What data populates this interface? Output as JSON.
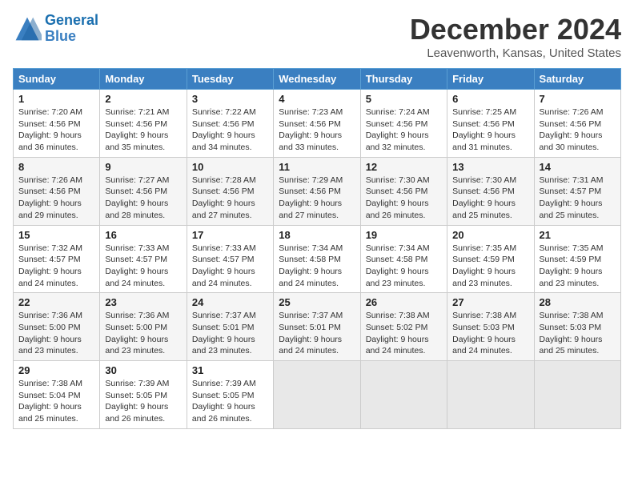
{
  "header": {
    "logo_line1": "General",
    "logo_line2": "Blue",
    "month_title": "December 2024",
    "location": "Leavenworth, Kansas, United States"
  },
  "days_of_week": [
    "Sunday",
    "Monday",
    "Tuesday",
    "Wednesday",
    "Thursday",
    "Friday",
    "Saturday"
  ],
  "weeks": [
    [
      {
        "day": "1",
        "sunrise": "7:20 AM",
        "sunset": "4:56 PM",
        "daylight": "9 hours and 36 minutes."
      },
      {
        "day": "2",
        "sunrise": "7:21 AM",
        "sunset": "4:56 PM",
        "daylight": "9 hours and 35 minutes."
      },
      {
        "day": "3",
        "sunrise": "7:22 AM",
        "sunset": "4:56 PM",
        "daylight": "9 hours and 34 minutes."
      },
      {
        "day": "4",
        "sunrise": "7:23 AM",
        "sunset": "4:56 PM",
        "daylight": "9 hours and 33 minutes."
      },
      {
        "day": "5",
        "sunrise": "7:24 AM",
        "sunset": "4:56 PM",
        "daylight": "9 hours and 32 minutes."
      },
      {
        "day": "6",
        "sunrise": "7:25 AM",
        "sunset": "4:56 PM",
        "daylight": "9 hours and 31 minutes."
      },
      {
        "day": "7",
        "sunrise": "7:26 AM",
        "sunset": "4:56 PM",
        "daylight": "9 hours and 30 minutes."
      }
    ],
    [
      {
        "day": "8",
        "sunrise": "7:26 AM",
        "sunset": "4:56 PM",
        "daylight": "9 hours and 29 minutes."
      },
      {
        "day": "9",
        "sunrise": "7:27 AM",
        "sunset": "4:56 PM",
        "daylight": "9 hours and 28 minutes."
      },
      {
        "day": "10",
        "sunrise": "7:28 AM",
        "sunset": "4:56 PM",
        "daylight": "9 hours and 27 minutes."
      },
      {
        "day": "11",
        "sunrise": "7:29 AM",
        "sunset": "4:56 PM",
        "daylight": "9 hours and 27 minutes."
      },
      {
        "day": "12",
        "sunrise": "7:30 AM",
        "sunset": "4:56 PM",
        "daylight": "9 hours and 26 minutes."
      },
      {
        "day": "13",
        "sunrise": "7:30 AM",
        "sunset": "4:56 PM",
        "daylight": "9 hours and 25 minutes."
      },
      {
        "day": "14",
        "sunrise": "7:31 AM",
        "sunset": "4:57 PM",
        "daylight": "9 hours and 25 minutes."
      }
    ],
    [
      {
        "day": "15",
        "sunrise": "7:32 AM",
        "sunset": "4:57 PM",
        "daylight": "9 hours and 24 minutes."
      },
      {
        "day": "16",
        "sunrise": "7:33 AM",
        "sunset": "4:57 PM",
        "daylight": "9 hours and 24 minutes."
      },
      {
        "day": "17",
        "sunrise": "7:33 AM",
        "sunset": "4:57 PM",
        "daylight": "9 hours and 24 minutes."
      },
      {
        "day": "18",
        "sunrise": "7:34 AM",
        "sunset": "4:58 PM",
        "daylight": "9 hours and 24 minutes."
      },
      {
        "day": "19",
        "sunrise": "7:34 AM",
        "sunset": "4:58 PM",
        "daylight": "9 hours and 23 minutes."
      },
      {
        "day": "20",
        "sunrise": "7:35 AM",
        "sunset": "4:59 PM",
        "daylight": "9 hours and 23 minutes."
      },
      {
        "day": "21",
        "sunrise": "7:35 AM",
        "sunset": "4:59 PM",
        "daylight": "9 hours and 23 minutes."
      }
    ],
    [
      {
        "day": "22",
        "sunrise": "7:36 AM",
        "sunset": "5:00 PM",
        "daylight": "9 hours and 23 minutes."
      },
      {
        "day": "23",
        "sunrise": "7:36 AM",
        "sunset": "5:00 PM",
        "daylight": "9 hours and 23 minutes."
      },
      {
        "day": "24",
        "sunrise": "7:37 AM",
        "sunset": "5:01 PM",
        "daylight": "9 hours and 23 minutes."
      },
      {
        "day": "25",
        "sunrise": "7:37 AM",
        "sunset": "5:01 PM",
        "daylight": "9 hours and 24 minutes."
      },
      {
        "day": "26",
        "sunrise": "7:38 AM",
        "sunset": "5:02 PM",
        "daylight": "9 hours and 24 minutes."
      },
      {
        "day": "27",
        "sunrise": "7:38 AM",
        "sunset": "5:03 PM",
        "daylight": "9 hours and 24 minutes."
      },
      {
        "day": "28",
        "sunrise": "7:38 AM",
        "sunset": "5:03 PM",
        "daylight": "9 hours and 25 minutes."
      }
    ],
    [
      {
        "day": "29",
        "sunrise": "7:38 AM",
        "sunset": "5:04 PM",
        "daylight": "9 hours and 25 minutes."
      },
      {
        "day": "30",
        "sunrise": "7:39 AM",
        "sunset": "5:05 PM",
        "daylight": "9 hours and 26 minutes."
      },
      {
        "day": "31",
        "sunrise": "7:39 AM",
        "sunset": "5:05 PM",
        "daylight": "9 hours and 26 minutes."
      },
      null,
      null,
      null,
      null
    ]
  ]
}
